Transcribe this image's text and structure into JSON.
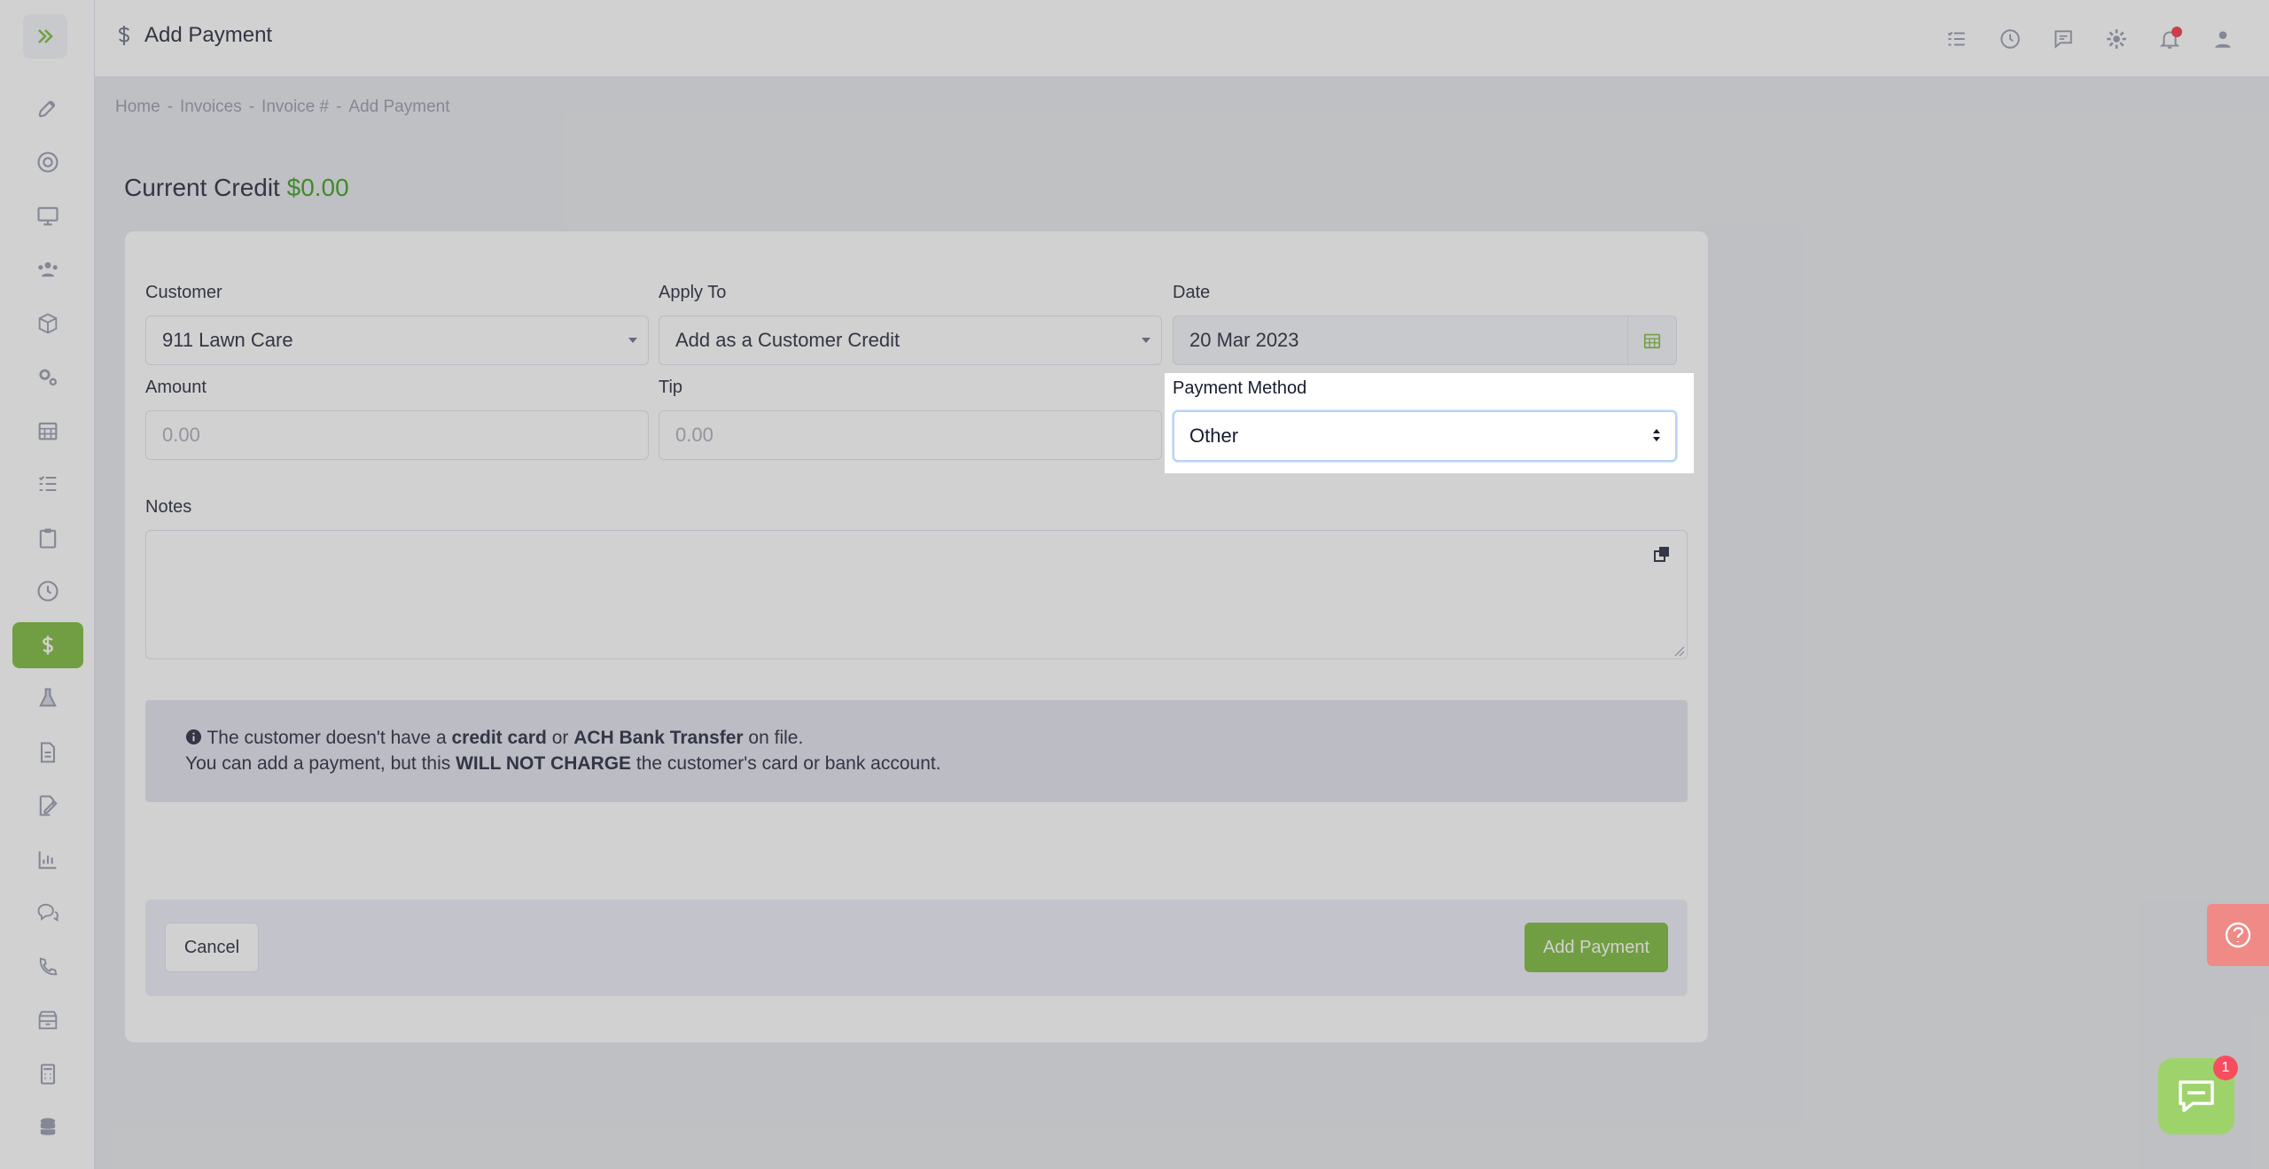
{
  "header": {
    "title": "Add Payment",
    "icons": [
      "tasks-icon",
      "clock-icon",
      "chat-icon",
      "gear-icon",
      "bell-icon",
      "user-icon"
    ]
  },
  "breadcrumb": [
    "Home",
    "-",
    "Invoices",
    "-",
    "Invoice #",
    "-",
    "Add Payment"
  ],
  "credit": {
    "label": "Current Credit",
    "amount": "$0.00"
  },
  "form": {
    "customer_label": "Customer",
    "customer_value": "911 Lawn Care",
    "apply_label": "Apply To",
    "apply_value": "Add as a Customer Credit",
    "date_label": "Date",
    "date_value": "20 Mar 2023",
    "amount_label": "Amount",
    "amount_placeholder": "0.00",
    "tip_label": "Tip",
    "tip_placeholder": "0.00",
    "method_label": "Payment Method",
    "method_value": "Other",
    "notes_label": "Notes"
  },
  "alert": {
    "line1_a": "The customer doesn't have a ",
    "line1_b": "credit card",
    "line1_c": " or ",
    "line1_d": "ACH Bank Transfer",
    "line1_e": " on file.",
    "line2_a": "You can add a payment, but this ",
    "line2_b": "WILL NOT CHARGE",
    "line2_c": " the customer's card or bank account."
  },
  "buttons": {
    "cancel": "Cancel",
    "add": "Add Payment"
  },
  "chat": {
    "badge": "1"
  },
  "colors": {
    "accent": "#8cc152",
    "credit": "#50a839",
    "danger": "#f64e60"
  }
}
